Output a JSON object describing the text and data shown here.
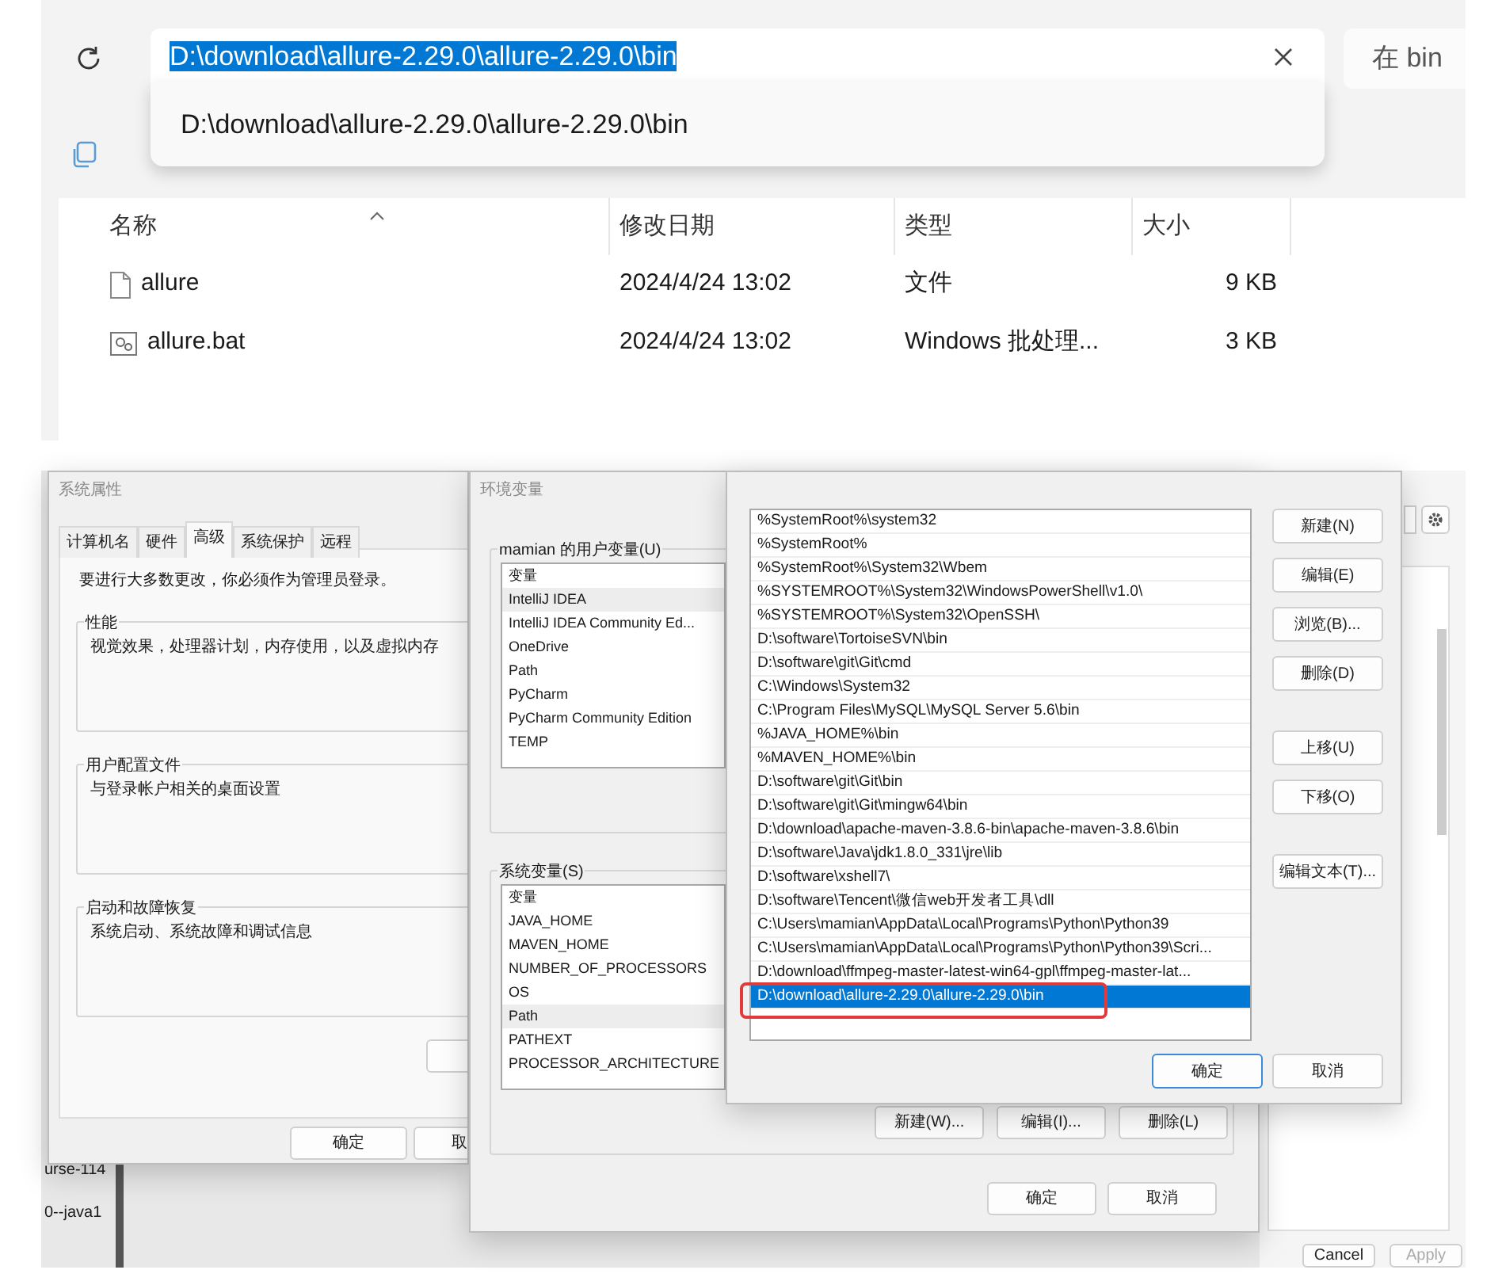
{
  "explorer": {
    "address": "D:\\download\\allure-2.29.0\\allure-2.29.0\\bin",
    "address_selected": true,
    "suggestion": "D:\\download\\allure-2.29.0\\allure-2.29.0\\bin",
    "search_placeholder": "在 bin",
    "columns": [
      "名称",
      "修改日期",
      "类型",
      "大小"
    ],
    "files": [
      {
        "kind": "file",
        "name": "allure",
        "modified": "2024/4/24 13:02",
        "type": "文件",
        "size": "9 KB"
      },
      {
        "kind": "batch",
        "name": "allure.bat",
        "modified": "2024/4/24 13:02",
        "type": "Windows 批处理...",
        "size": "3 KB"
      }
    ]
  },
  "background": {
    "sidebar_items": [
      "urse-114",
      "0--java1"
    ],
    "buttons": [
      {
        "label": "Cancel",
        "disabled": false
      },
      {
        "label": "Apply",
        "disabled": true
      }
    ]
  },
  "system_properties": {
    "title": "系统属性",
    "tabs": [
      {
        "label": "计算机名",
        "selected": false
      },
      {
        "label": "硬件",
        "selected": false
      },
      {
        "label": "高级",
        "selected": true
      },
      {
        "label": "系统保护",
        "selected": false
      },
      {
        "label": "远程",
        "selected": false
      }
    ],
    "notice": "要进行大多数更改，你必须作为管理员登录。",
    "groups": [
      {
        "title": "性能",
        "description": "视觉效果，处理器计划，内存使用，以及虚拟内存"
      },
      {
        "title": "用户配置文件",
        "description": "与登录帐户相关的桌面设置"
      },
      {
        "title": "启动和故障恢复",
        "description": "系统启动、系统故障和调试信息"
      }
    ],
    "buttons": [
      "确定",
      "取"
    ]
  },
  "environment_variables": {
    "title": "环境变量",
    "user_group": "mamian 的用户变量(U)",
    "user_vars": {
      "header": "变量",
      "rows": [
        {
          "name": "IntelliJ IDEA",
          "selected": true
        },
        {
          "name": "IntelliJ IDEA Community Ed...",
          "selected": false
        },
        {
          "name": "OneDrive",
          "selected": false
        },
        {
          "name": "Path",
          "selected": false
        },
        {
          "name": "PyCharm",
          "selected": false
        },
        {
          "name": "PyCharm Community Edition",
          "selected": false
        },
        {
          "name": "TEMP",
          "selected": false
        }
      ]
    },
    "system_group": "系统变量(S)",
    "system_vars": {
      "header": "变量",
      "rows": [
        {
          "name": "JAVA_HOME",
          "selected": false
        },
        {
          "name": "MAVEN_HOME",
          "selected": false
        },
        {
          "name": "NUMBER_OF_PROCESSORS",
          "selected": false
        },
        {
          "name": "OS",
          "selected": false
        },
        {
          "name": "Path",
          "selected": true
        },
        {
          "name": "PATHEXT",
          "selected": false
        },
        {
          "name": "PROCESSOR_ARCHITECTURE",
          "selected": false
        }
      ]
    },
    "system_buttons": [
      "新建(W)...",
      "编辑(I)...",
      "删除(L)"
    ],
    "buttons": [
      "确定",
      "取消"
    ]
  },
  "edit_variable": {
    "items": [
      {
        "text": "%SystemRoot%\\system32",
        "selected": false,
        "highlighted": false
      },
      {
        "text": "%SystemRoot%",
        "selected": false,
        "highlighted": false
      },
      {
        "text": "%SystemRoot%\\System32\\Wbem",
        "selected": false,
        "highlighted": false
      },
      {
        "text": "%SYSTEMROOT%\\System32\\WindowsPowerShell\\v1.0\\",
        "selected": false,
        "highlighted": false
      },
      {
        "text": "%SYSTEMROOT%\\System32\\OpenSSH\\",
        "selected": false,
        "highlighted": false
      },
      {
        "text": "D:\\software\\TortoiseSVN\\bin",
        "selected": false,
        "highlighted": false
      },
      {
        "text": "D:\\software\\git\\Git\\cmd",
        "selected": false,
        "highlighted": false
      },
      {
        "text": "C:\\Windows\\System32",
        "selected": false,
        "highlighted": false
      },
      {
        "text": "C:\\Program Files\\MySQL\\MySQL Server 5.6\\bin",
        "selected": false,
        "highlighted": false
      },
      {
        "text": "%JAVA_HOME%\\bin",
        "selected": false,
        "highlighted": false
      },
      {
        "text": "%MAVEN_HOME%\\bin",
        "selected": false,
        "highlighted": false
      },
      {
        "text": "D:\\software\\git\\Git\\bin",
        "selected": false,
        "highlighted": false
      },
      {
        "text": "D:\\software\\git\\Git\\mingw64\\bin",
        "selected": false,
        "highlighted": false
      },
      {
        "text": "D:\\download\\apache-maven-3.8.6-bin\\apache-maven-3.8.6\\bin",
        "selected": false,
        "highlighted": false
      },
      {
        "text": "D:\\software\\Java\\jdk1.8.0_331\\jre\\lib",
        "selected": false,
        "highlighted": false
      },
      {
        "text": "D:\\software\\xshell7\\",
        "selected": false,
        "highlighted": false
      },
      {
        "text": "D:\\software\\Tencent\\微信web开发者工具\\dll",
        "selected": false,
        "highlighted": false
      },
      {
        "text": "C:\\Users\\mamian\\AppData\\Local\\Programs\\Python\\Python39",
        "selected": false,
        "highlighted": false
      },
      {
        "text": "C:\\Users\\mamian\\AppData\\Local\\Programs\\Python\\Python39\\Scri...",
        "selected": false,
        "highlighted": false
      },
      {
        "text": "D:\\download\\ffmpeg-master-latest-win64-gpl\\ffmpeg-master-lat...",
        "selected": false,
        "highlighted": false
      },
      {
        "text": "D:\\download\\allure-2.29.0\\allure-2.29.0\\bin",
        "selected": true,
        "highlighted": true
      }
    ],
    "button_groups": [
      [
        "新建(N)",
        "编辑(E)",
        "浏览(B)...",
        "删除(D)"
      ],
      [
        "上移(U)",
        "下移(O)"
      ],
      [
        "编辑文本(T)..."
      ]
    ],
    "buttons": [
      {
        "label": "确定",
        "default": true
      },
      {
        "label": "取消",
        "default": false
      }
    ]
  }
}
